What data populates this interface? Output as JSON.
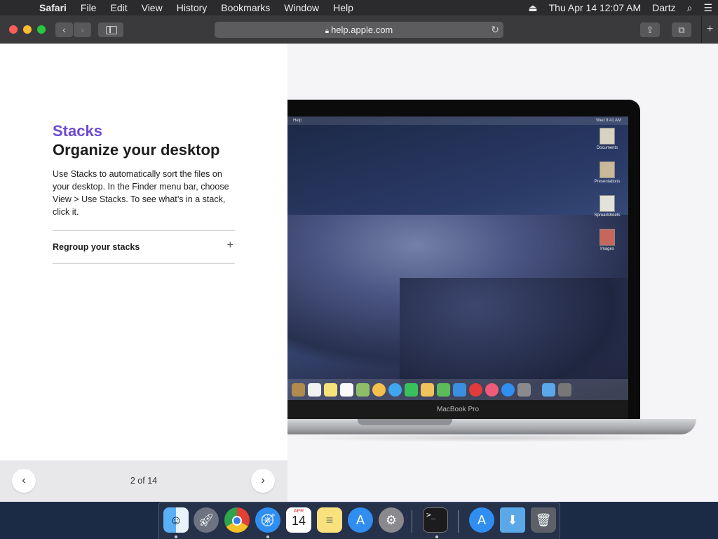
{
  "menubar": {
    "app_name": "Safari",
    "menus": [
      "File",
      "Edit",
      "View",
      "History",
      "Bookmarks",
      "Window",
      "Help"
    ],
    "datetime": "Thu Apr 14  12:07 AM",
    "user": "Dartz"
  },
  "toolbar": {
    "url": "help.apple.com",
    "back_glyph": "‹",
    "forward_glyph": "›"
  },
  "article": {
    "eyebrow": "Stacks",
    "headline": "Organize your desktop",
    "body": "Use Stacks to automatically sort the files on your desktop. In the Finder menu bar, choose View > Use Stacks. To see what’s in a stack, click it.",
    "accordion_label": "Regroup your stacks"
  },
  "pager": {
    "count": "2 of 14"
  },
  "illustration": {
    "mini_menu_app": "Help",
    "mini_menu_time": "Wed 9:41 AM",
    "desktop_icons": [
      "Documents",
      "Presentations",
      "Spreadsheets",
      "Images"
    ],
    "bezel_label": "MacBook Pro"
  },
  "dock": {
    "apps": [
      "finder-icon",
      "launchpad-icon",
      "chrome-icon",
      "safari-icon",
      "calendar-icon",
      "notes-icon",
      "app-store-icon",
      "system-preferences-icon",
      "terminal-icon",
      "app-store-folder-icon",
      "downloads-folder-icon",
      "trash-icon"
    ],
    "calendar_month": "APR",
    "calendar_day": "14"
  },
  "colors": {
    "accent_purple": "#6e4bd1",
    "close": "#fc5f57",
    "minimize": "#fdbc2e",
    "zoom": "#28c840"
  }
}
